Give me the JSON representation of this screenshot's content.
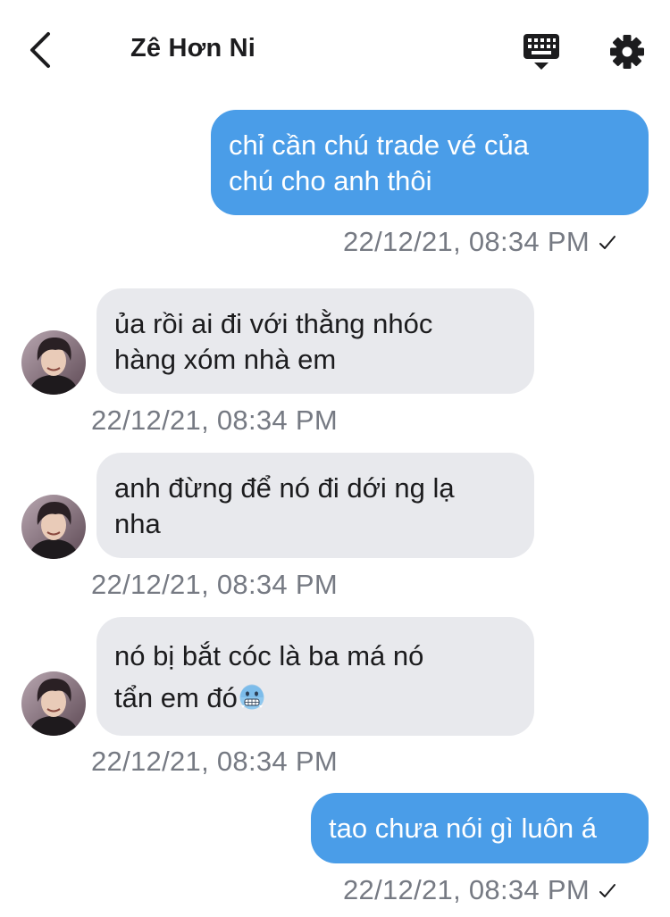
{
  "header": {
    "title": "Zê Hơn Ni",
    "back_icon": "chevron-left-icon",
    "keyboard_icon": "keyboard-icon",
    "settings_icon": "gear-icon"
  },
  "colors": {
    "outgoing_bubble": "#4a9de8",
    "incoming_bubble": "#e8e9ed",
    "timestamp": "#767a83"
  },
  "messages": [
    {
      "direction": "outgoing",
      "lines": [
        "chỉ cần chú trade vé của",
        "chú cho anh thôi"
      ],
      "timestamp": "22/12/21, 08:34 PM",
      "status_icon": "checkmark-icon"
    },
    {
      "direction": "incoming",
      "lines": [
        "ủa rồi ai đi với thằng nhóc",
        "hàng xóm nhà em"
      ],
      "timestamp": "22/12/21, 08:34 PM"
    },
    {
      "direction": "incoming",
      "lines": [
        "anh đừng để nó đi dới ng lạ",
        "nha"
      ],
      "timestamp": "22/12/21, 08:34 PM"
    },
    {
      "direction": "incoming",
      "lines": [
        "nó bị bắt cóc là ba má nó",
        "tẩn em đó"
      ],
      "emoji": "cold-face-emoji",
      "timestamp": "22/12/21, 08:34 PM"
    },
    {
      "direction": "outgoing",
      "lines": [
        "tao chưa nói gì luôn á"
      ],
      "timestamp": "22/12/21, 08:34 PM",
      "status_icon": "checkmark-icon"
    }
  ]
}
